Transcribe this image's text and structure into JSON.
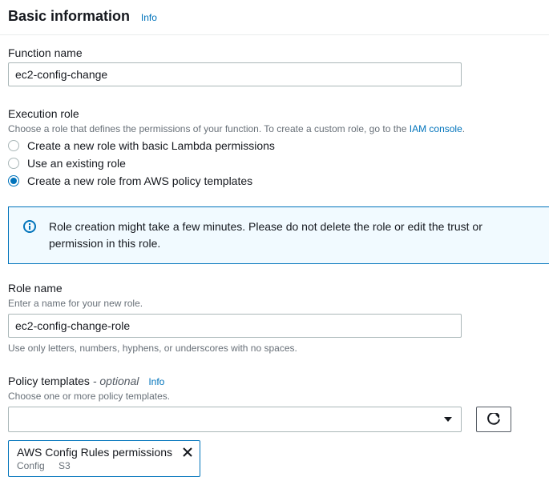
{
  "header": {
    "title": "Basic information",
    "info_link": "Info"
  },
  "function_name": {
    "label": "Function name",
    "value": "ec2-config-change"
  },
  "execution_role": {
    "label": "Execution role",
    "hint_prefix": "Choose a role that defines the permissions of your function. To create a custom role, go to the ",
    "hint_link": "IAM console",
    "hint_suffix": ".",
    "options": [
      "Create a new role with basic Lambda permissions",
      "Use an existing role",
      "Create a new role from AWS policy templates"
    ],
    "selected_index": 2
  },
  "alert": {
    "text": "Role creation might take a few minutes. Please do not delete the role or edit the trust or permission in this role."
  },
  "role_name": {
    "label": "Role name",
    "hint": "Enter a name for your new role.",
    "value": "ec2-config-change-role",
    "below_hint": "Use only letters, numbers, hyphens, or underscores with no spaces."
  },
  "policy_templates": {
    "label_text": "Policy templates",
    "optional_suffix": " - optional",
    "info_link": "Info",
    "hint": "Choose one or more policy templates.",
    "token": {
      "title": "AWS Config Rules permissions",
      "tags": [
        "Config",
        "S3"
      ]
    }
  }
}
